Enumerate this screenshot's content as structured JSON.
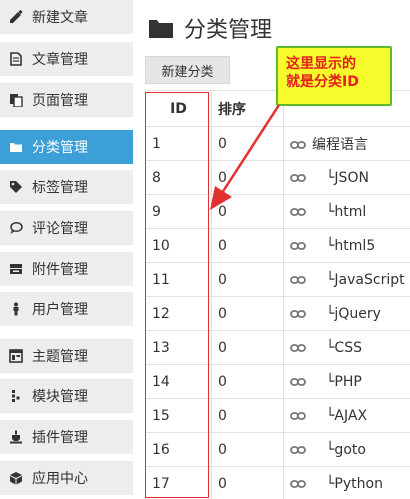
{
  "sidebar": {
    "items": [
      {
        "label": "新建文章",
        "icon": "edit-icon"
      },
      {
        "label": "文章管理",
        "icon": "document-icon"
      },
      {
        "label": "页面管理",
        "icon": "pages-icon"
      },
      {
        "label": "分类管理",
        "icon": "folder-icon"
      },
      {
        "label": "标签管理",
        "icon": "tag-icon"
      },
      {
        "label": "评论管理",
        "icon": "comment-icon"
      },
      {
        "label": "附件管理",
        "icon": "attachment-icon"
      },
      {
        "label": "用户管理",
        "icon": "user-icon"
      },
      {
        "label": "主题管理",
        "icon": "theme-icon"
      },
      {
        "label": "模块管理",
        "icon": "module-icon"
      },
      {
        "label": "插件管理",
        "icon": "plugin-icon"
      },
      {
        "label": "应用中心",
        "icon": "app-center-icon"
      }
    ],
    "active_index": 3
  },
  "header": {
    "title": "分类管理"
  },
  "toolbar": {
    "new_category_label": "新建分类"
  },
  "table": {
    "headers": [
      "ID",
      "排序",
      ""
    ],
    "rows": [
      {
        "id": "1",
        "order": "0",
        "name": "编程语言",
        "child": false
      },
      {
        "id": "8",
        "order": "0",
        "name": "└JSON",
        "child": true
      },
      {
        "id": "9",
        "order": "0",
        "name": "└html",
        "child": true
      },
      {
        "id": "10",
        "order": "0",
        "name": "└html5",
        "child": true
      },
      {
        "id": "11",
        "order": "0",
        "name": "└JavaScript",
        "child": true
      },
      {
        "id": "12",
        "order": "0",
        "name": "└jQuery",
        "child": true
      },
      {
        "id": "13",
        "order": "0",
        "name": "└CSS",
        "child": true
      },
      {
        "id": "14",
        "order": "0",
        "name": "└PHP",
        "child": true
      },
      {
        "id": "15",
        "order": "0",
        "name": "└AJAX",
        "child": true
      },
      {
        "id": "16",
        "order": "0",
        "name": "└goto",
        "child": true
      },
      {
        "id": "17",
        "order": "0",
        "name": "└Python",
        "child": true
      }
    ]
  },
  "annotation": {
    "line1": "这里显示的",
    "line2": "就是分类ID",
    "colors": {
      "box_fill": "#f7fb2c",
      "box_border": "#5fb82a",
      "text": "#e3201b",
      "highlight": "#e23030"
    }
  },
  "colors": {
    "active_nav": "#3c9fd8",
    "nav_bg": "#ededed"
  }
}
